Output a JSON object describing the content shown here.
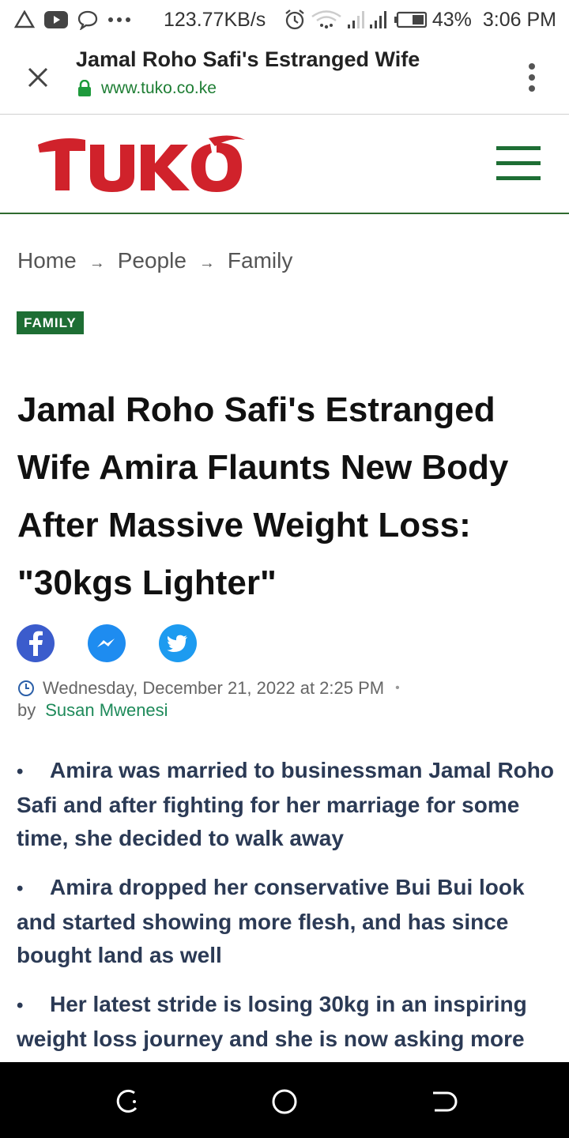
{
  "status_bar": {
    "network_speed": "123.77KB/s",
    "battery": "43%",
    "time": "3:06 PM"
  },
  "browser": {
    "tab_title": "Jamal Roho Safi's Estranged Wife",
    "url": "www.tuko.co.ke"
  },
  "site": {
    "logo_text": "TUKO",
    "brand_color": "#d0222b",
    "accent_color": "#1e6e34"
  },
  "breadcrumb": [
    "Home",
    "People",
    "Family"
  ],
  "breadcrumb_separator": "→",
  "category": "FAMILY",
  "article": {
    "title": "Jamal Roho Safi's Estranged Wife Amira Flaunts New Body After Massive Weight Loss: \"30kgs Lighter\"",
    "date": "Wednesday, December 21, 2022 at 2:25 PM",
    "by_label": "by",
    "author": "Susan Mwenesi",
    "highlights": [
      "Amira was married to businessman Jamal Roho Safi and after fighting for her marriage for some time, she decided to walk away",
      "Amira dropped her conservative Bui Bui look and started showing more flesh, and has since bought land as well",
      "Her latest stride is losing 30kg in an inspiring weight loss journey and she is now asking more"
    ]
  },
  "share_icons": [
    "facebook-icon",
    "messenger-icon",
    "twitter-icon"
  ]
}
